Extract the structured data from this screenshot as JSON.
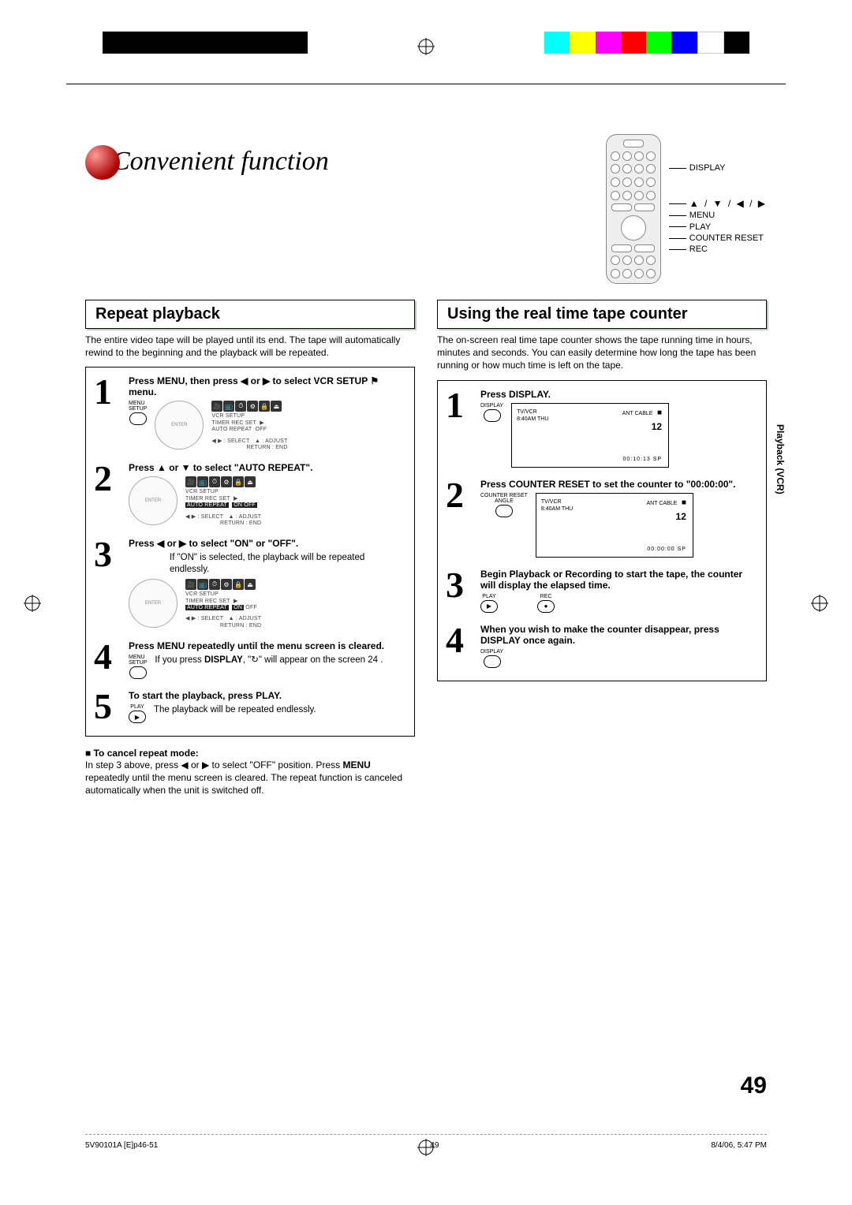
{
  "header": {
    "title": "Convenient function"
  },
  "remoteLabels": {
    "display": "DISPLAY",
    "arrows": "▲ / ▼ / ◀ / ▶",
    "menu": "MENU",
    "play": "PLAY",
    "counterReset": "COUNTER RESET",
    "rec": "REC"
  },
  "left": {
    "heading": "Repeat playback",
    "intro": "The entire video tape will be played until its end. The tape will automatically rewind to the beginning and the playback will be repeated.",
    "step1_title": "Press MENU, then press ◀ or ▶ to select VCR SETUP ⚑ menu.",
    "step2_title": "Press ▲ or ▼ to select \"AUTO REPEAT\".",
    "step3_title": "Press ◀ or ▶ to select \"ON\" or \"OFF\".",
    "step3_desc": "If \"ON\" is selected, the playback will be repeated endlessly.",
    "step4_title": "Press MENU repeatedly until the menu screen is cleared.",
    "step4_desc_a": "If you press ",
    "step4_desc_b": "DISPLAY",
    "step4_desc_c": ", \"↻\" will appear on the screen  24 .",
    "step5_title": "To start the playback, press PLAY.",
    "step5_desc": "The playback will be repeated endlessly.",
    "osd": {
      "menuTitle": "VCR SETUP",
      "line1": "TIMER REC SET",
      "line2": "AUTO REPEAT",
      "off": "OFF",
      "on_off": "ON  OFF",
      "selectHint": "◀ ▶ : SELECT",
      "adjustHint": "▲ : ADJUST",
      "returnHint": "RETURN : END"
    },
    "menuSetupBtn": "MENU\nSETUP",
    "playBtn": "PLAY",
    "cancel": {
      "heading": "To cancel repeat mode:",
      "body_a": "In step 3 above, press ◀ or ▶ to select \"OFF\" position. Press ",
      "body_b": "MENU",
      "body_c": " repeatedly until the menu screen is cleared. The repeat function is canceled automatically when the unit is switched off."
    }
  },
  "right": {
    "heading": "Using the real time tape counter",
    "intro": "The on-screen real time tape counter shows the tape running time in hours, minutes and seconds. You can easily determine how long the tape has been running or how much time is left on the tape.",
    "step1_title": "Press DISPLAY.",
    "step2_title": "Press COUNTER RESET to set the counter to \"00:00:00\".",
    "step3_title": "Begin Playback or Recording to start the tape, the counter will display the elapsed time.",
    "step4_title": "When you wish to make the counter disappear, press DISPLAY once again.",
    "displayBtn": "DISPLAY",
    "counterResetBtn": "COUNTER RESET\nANGLE",
    "playBtn": "PLAY",
    "recBtn": "REC",
    "osd1": {
      "lineA": "TV/VCR",
      "lineB": "8:40AM THU",
      "corner1": "ANT CABLE",
      "stop": "■",
      "ch": "12",
      "time": "00:10:13  SP"
    },
    "osd2": {
      "lineA": "TV/VCR",
      "lineB": "8:40AM THU",
      "corner1": "ANT CABLE",
      "stop": "■",
      "ch": "12",
      "time": "00:00:00  SP"
    }
  },
  "sideTab": "Playback (VCR)",
  "pageNumber": "49",
  "footer": {
    "left": "5V90101A [E]p46-51",
    "center": "49",
    "right": "8/4/06, 5:47 PM"
  }
}
